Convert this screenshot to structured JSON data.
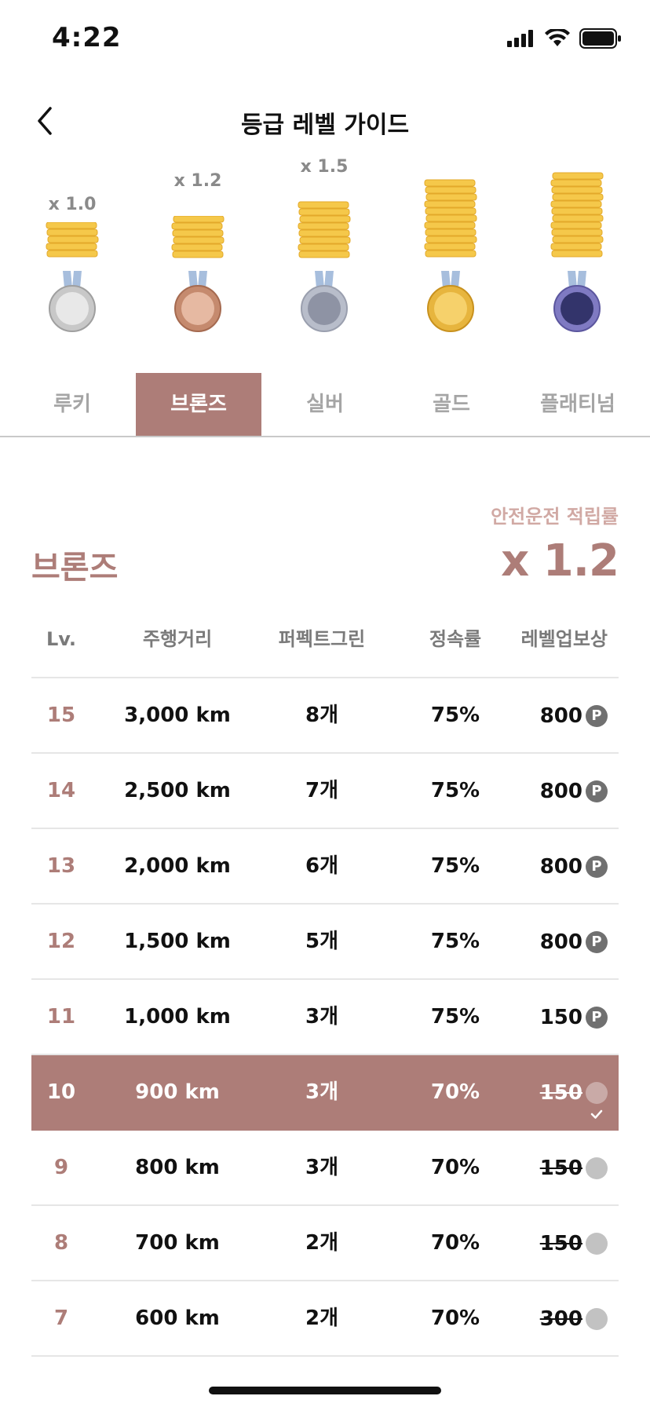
{
  "status": {
    "time": "4:22"
  },
  "header": {
    "title": "등급 레벨 가이드"
  },
  "tiers": [
    {
      "multiplier": "x 1.0",
      "medal_color": "#c8c8c8",
      "medal_inner": "#e8e8e8"
    },
    {
      "multiplier": "x 1.2",
      "medal_color": "#c58a6e",
      "medal_inner": "#e6b9a2"
    },
    {
      "multiplier": "x 1.5",
      "medal_color": "#b8bdca",
      "medal_inner": "#8e93a4"
    },
    {
      "multiplier": "",
      "medal_color": "#e7b53e",
      "medal_inner": "#f6d16b"
    },
    {
      "multiplier": "",
      "medal_color": "#7f7ac2",
      "medal_inner": "#33346b"
    }
  ],
  "tabs": [
    "루키",
    "브론즈",
    "실버",
    "골드",
    "플래티넘"
  ],
  "active_tab": 1,
  "info": {
    "label": "안전운전 적립률",
    "tier_name": "브론즈",
    "multiplier": "x 1.2"
  },
  "table": {
    "headers": [
      "Lv.",
      "주행거리",
      "퍼펙트그린",
      "정속률",
      "레벨업보상"
    ],
    "rows": [
      {
        "lv": "15",
        "distance": "3,000 km",
        "green": "8개",
        "rate": "75%",
        "reward": "800",
        "claimed": false
      },
      {
        "lv": "14",
        "distance": "2,500 km",
        "green": "7개",
        "rate": "75%",
        "reward": "800",
        "claimed": false
      },
      {
        "lv": "13",
        "distance": "2,000 km",
        "green": "6개",
        "rate": "75%",
        "reward": "800",
        "claimed": false
      },
      {
        "lv": "12",
        "distance": "1,500 km",
        "green": "5개",
        "rate": "75%",
        "reward": "800",
        "claimed": false
      },
      {
        "lv": "11",
        "distance": "1,000 km",
        "green": "3개",
        "rate": "75%",
        "reward": "150",
        "claimed": false
      },
      {
        "lv": "10",
        "distance": "900 km",
        "green": "3개",
        "rate": "70%",
        "reward": "150",
        "claimed": true,
        "current": true
      },
      {
        "lv": "9",
        "distance": "800 km",
        "green": "3개",
        "rate": "70%",
        "reward": "150",
        "claimed": true
      },
      {
        "lv": "8",
        "distance": "700 km",
        "green": "2개",
        "rate": "70%",
        "reward": "150",
        "claimed": true
      },
      {
        "lv": "7",
        "distance": "600 km",
        "green": "2개",
        "rate": "70%",
        "reward": "300",
        "claimed": true
      }
    ],
    "point_icon": "P"
  },
  "colors": {
    "accent": "#ad7d78",
    "accent_light": "#d1a9a4",
    "coin": "#f5c84a"
  }
}
